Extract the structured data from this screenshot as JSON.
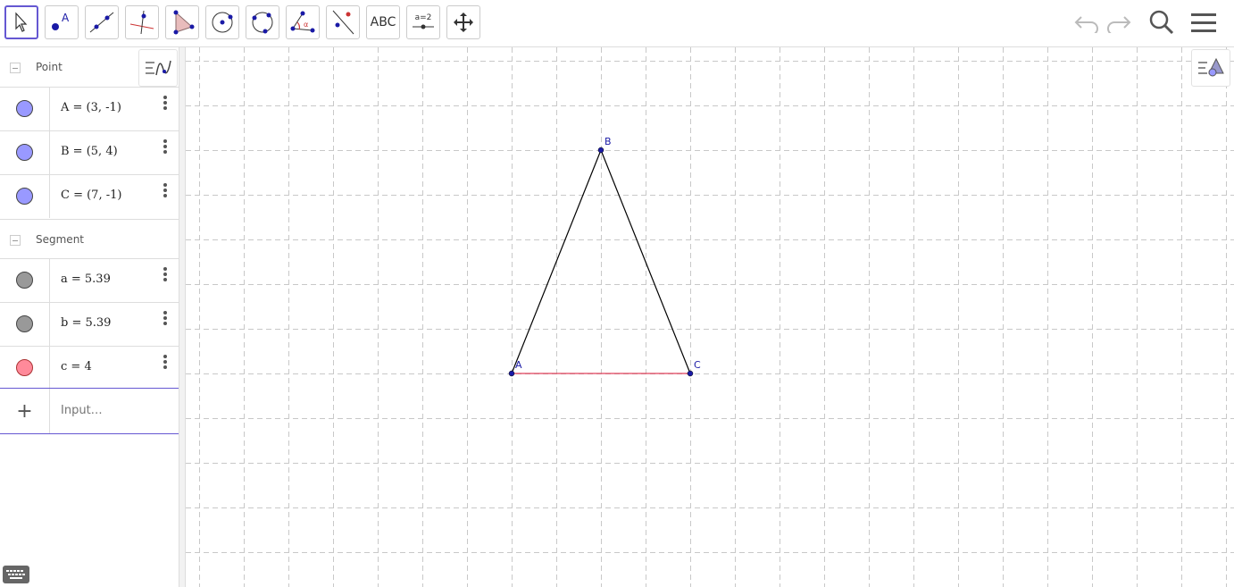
{
  "toolbar": {
    "tools": [
      {
        "name": "move-tool-button",
        "active": true
      },
      {
        "name": "point-tool-button",
        "label": "A"
      },
      {
        "name": "line-tool-button"
      },
      {
        "name": "perpendicular-tool-button"
      },
      {
        "name": "polygon-tool-button"
      },
      {
        "name": "circle-center-tool-button"
      },
      {
        "name": "circle-3points-tool-button"
      },
      {
        "name": "angle-tool-button",
        "label": "α"
      },
      {
        "name": "reflect-tool-button"
      },
      {
        "name": "text-tool-button",
        "label": "ABC"
      },
      {
        "name": "slider-tool-button",
        "label": "a=2"
      },
      {
        "name": "move-graphics-tool-button"
      }
    ]
  },
  "algebra": {
    "groups": [
      {
        "label": "Point"
      },
      {
        "label": "Segment"
      }
    ],
    "points": [
      {
        "expr": "A = (3, -1)",
        "color": "#9999ff"
      },
      {
        "expr": "B = (5, 4)",
        "color": "#9999ff"
      },
      {
        "expr": "C = (7, -1)",
        "color": "#9999ff"
      }
    ],
    "segments": [
      {
        "expr": "a = 5.39",
        "color": "#999999"
      },
      {
        "expr": "b = 5.39",
        "color": "#999999"
      },
      {
        "expr": "c = 4",
        "color": "#ff8a9a"
      }
    ],
    "input_placeholder": "Input…"
  },
  "graphics": {
    "points": [
      {
        "label": "A",
        "x": 3,
        "y": -1
      },
      {
        "label": "B",
        "x": 5,
        "y": 4
      },
      {
        "label": "C",
        "x": 7,
        "y": -1
      }
    ],
    "segments": [
      {
        "from": "B",
        "to": "C",
        "color": "#000000"
      },
      {
        "from": "A",
        "to": "B",
        "color": "#000000"
      },
      {
        "from": "A",
        "to": "C",
        "color": "#e0405a"
      }
    ],
    "grid": "dashed",
    "point_color": "#1a1aa6"
  }
}
